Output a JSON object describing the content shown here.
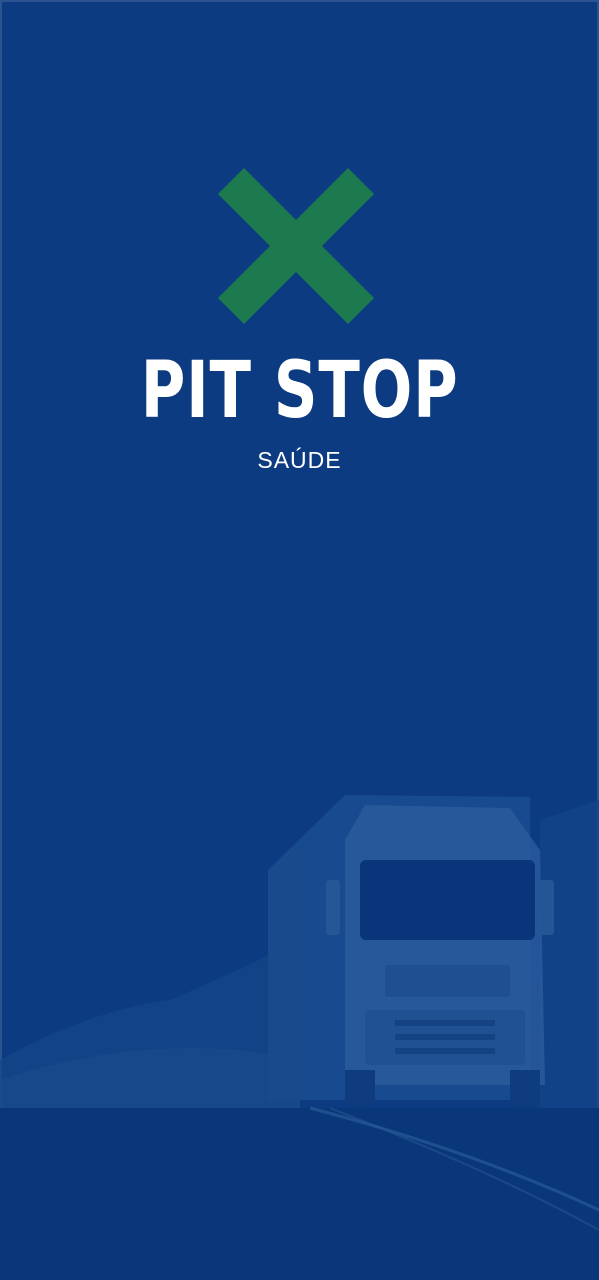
{
  "brand": {
    "title": "PIT STOP",
    "subtitle": "SAÚDE"
  },
  "icons": {
    "logo": "green-cross-x-icon",
    "background": "truck-on-road-photo"
  },
  "colors": {
    "background": "#0c3b81",
    "logo_green": "#1d7a4e",
    "text": "#ffffff"
  }
}
